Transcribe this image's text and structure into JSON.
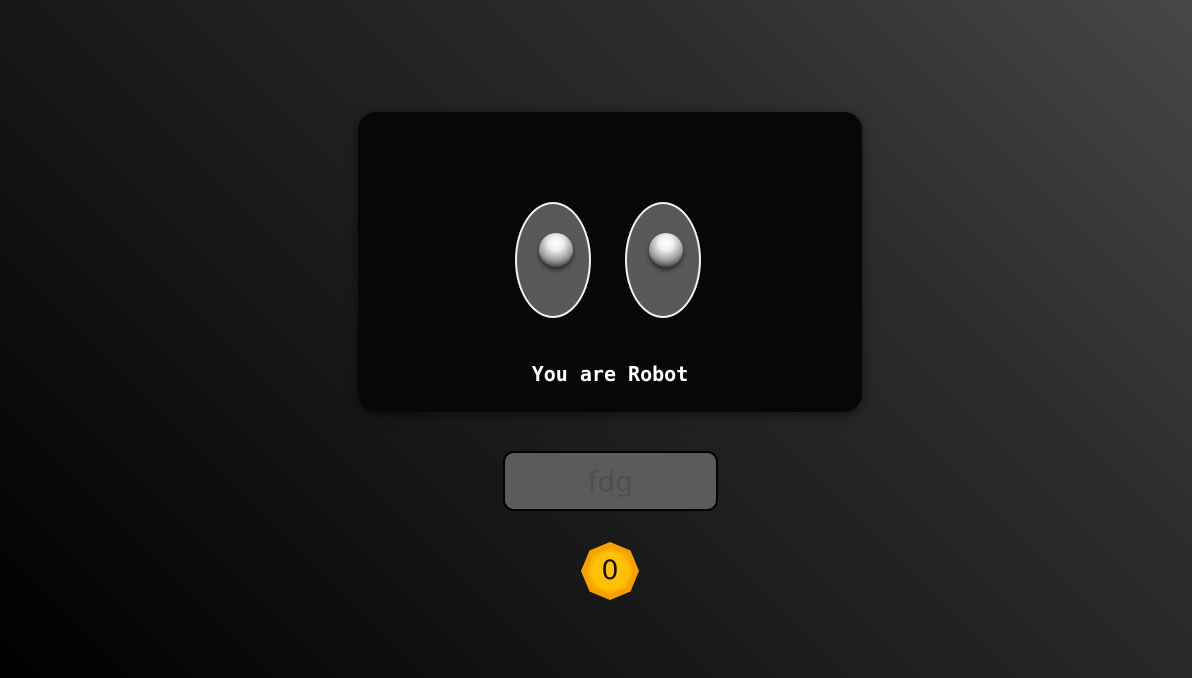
{
  "robot": {
    "message": "You are Robot"
  },
  "input": {
    "value": "fdg"
  },
  "coin": {
    "count": "0",
    "icon": "coin-badge-icon",
    "outer_color": "#f5a200",
    "inner_color": "#ffc107"
  }
}
